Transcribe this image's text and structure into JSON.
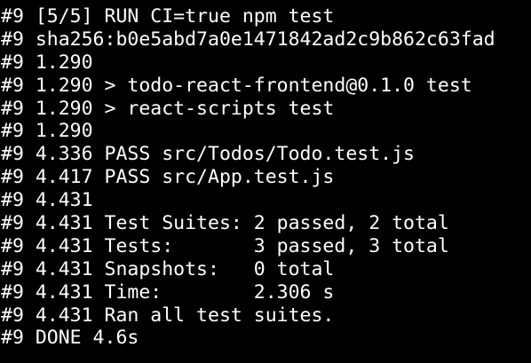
{
  "terminal": {
    "lines": [
      "#9 [5/5] RUN CI=true npm test",
      "#9 sha256:b0e5abd7a0e1471842ad2c9b862c63fad",
      "#9 1.290",
      "#9 1.290 > todo-react-frontend@0.1.0 test",
      "#9 1.290 > react-scripts test",
      "#9 1.290",
      "#9 4.336 PASS src/Todos/Todo.test.js",
      "#9 4.417 PASS src/App.test.js",
      "#9 4.431",
      "#9 4.431 Test Suites: 2 passed, 2 total",
      "#9 4.431 Tests:       3 passed, 3 total",
      "#9 4.431 Snapshots:   0 total",
      "#9 4.431 Time:        2.306 s",
      "#9 4.431 Ran all test suites.",
      "#9 DONE 4.6s"
    ]
  },
  "colors": {
    "background": "#000000",
    "text": "#ffffff"
  }
}
